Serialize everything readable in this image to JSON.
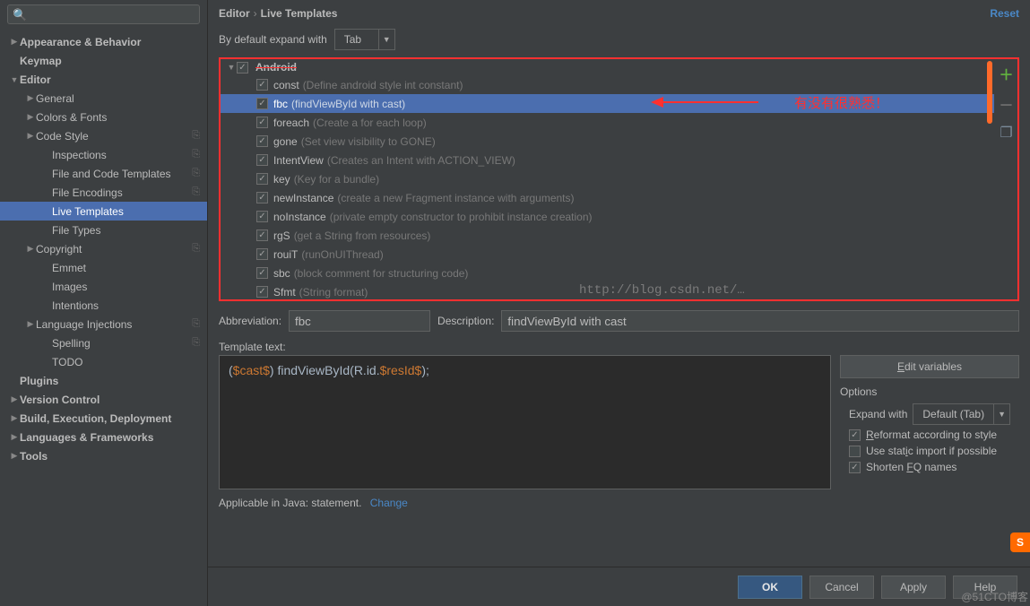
{
  "breadcrumb": {
    "root": "Editor",
    "leaf": "Live Templates"
  },
  "reset_label": "Reset",
  "expand_row": {
    "label": "By default expand with",
    "value": "Tab"
  },
  "sidebar": {
    "search_placeholder": "",
    "items": [
      {
        "label": "Appearance & Behavior",
        "bold": true,
        "indent": 0,
        "arrow": "closed"
      },
      {
        "label": "Keymap",
        "bold": true,
        "indent": 0
      },
      {
        "label": "Editor",
        "bold": true,
        "indent": 0,
        "arrow": "open"
      },
      {
        "label": "General",
        "indent": 1,
        "arrow": "closed"
      },
      {
        "label": "Colors & Fonts",
        "indent": 1,
        "arrow": "closed"
      },
      {
        "label": "Code Style",
        "indent": 1,
        "arrow": "closed",
        "copy": true
      },
      {
        "label": "Inspections",
        "indent": 2,
        "copy": true
      },
      {
        "label": "File and Code Templates",
        "indent": 2,
        "copy": true
      },
      {
        "label": "File Encodings",
        "indent": 2,
        "copy": true
      },
      {
        "label": "Live Templates",
        "indent": 2,
        "selected": true
      },
      {
        "label": "File Types",
        "indent": 2
      },
      {
        "label": "Copyright",
        "indent": 1,
        "arrow": "closed",
        "copy": true
      },
      {
        "label": "Emmet",
        "indent": 2
      },
      {
        "label": "Images",
        "indent": 2
      },
      {
        "label": "Intentions",
        "indent": 2
      },
      {
        "label": "Language Injections",
        "indent": 1,
        "arrow": "closed",
        "copy": true
      },
      {
        "label": "Spelling",
        "indent": 2,
        "copy": true
      },
      {
        "label": "TODO",
        "indent": 2
      },
      {
        "label": "Plugins",
        "bold": true,
        "indent": 0
      },
      {
        "label": "Version Control",
        "bold": true,
        "indent": 0,
        "arrow": "closed"
      },
      {
        "label": "Build, Execution, Deployment",
        "bold": true,
        "indent": 0,
        "arrow": "closed"
      },
      {
        "label": "Languages & Frameworks",
        "bold": true,
        "indent": 0,
        "arrow": "closed"
      },
      {
        "label": "Tools",
        "bold": true,
        "indent": 0,
        "arrow": "closed"
      }
    ]
  },
  "template_group": "Android",
  "templates": [
    {
      "abbr": "const",
      "desc": "(Define android style int constant)"
    },
    {
      "abbr": "fbc",
      "desc": "(findViewById with cast)",
      "selected": true
    },
    {
      "abbr": "foreach",
      "desc": "(Create a for each loop)"
    },
    {
      "abbr": "gone",
      "desc": "(Set view visibility to GONE)"
    },
    {
      "abbr": "IntentView",
      "desc": "(Creates an Intent with ACTION_VIEW)"
    },
    {
      "abbr": "key",
      "desc": "(Key for a bundle)"
    },
    {
      "abbr": "newInstance",
      "desc": "(create a new Fragment instance with arguments)"
    },
    {
      "abbr": "noInstance",
      "desc": "(private empty constructor to prohibit instance creation)"
    },
    {
      "abbr": "rgS",
      "desc": "(get a String from resources)"
    },
    {
      "abbr": "rouiT",
      "desc": "(runOnUIThread)"
    },
    {
      "abbr": "sbc",
      "desc": "(block comment for structuring code)"
    },
    {
      "abbr": "Sfmt",
      "desc": "(String format)"
    }
  ],
  "annotations": {
    "red_text": "有没有很熟悉！",
    "watermark": "http://blog.csdn.net/…"
  },
  "fields": {
    "abbrev_label": "Abbreviation:",
    "abbrev_value": "fbc",
    "desc_label": "Description:",
    "desc_value": "findViewById with cast",
    "template_text_label": "Template text:",
    "template_text_parts": {
      "p1": "(",
      "v1": "$cast$",
      "p2": ") findViewById(R.id.",
      "v2": "$resId$",
      "p3": ");"
    }
  },
  "right": {
    "edit_vars": "Edit variables",
    "options_title": "Options",
    "expand_with_label": "Expand with",
    "expand_with_value": "Default (Tab)",
    "reformat": "Reformat according to style",
    "static_import": "Use static import if possible",
    "shorten_fq": "Shorten FQ names"
  },
  "applicable": {
    "prefix": "Applicable in Java: statement.",
    "change": "Change"
  },
  "footer": {
    "ok": "OK",
    "cancel": "Cancel",
    "apply": "Apply",
    "help": "Help"
  },
  "corner_badge": "@51CTO博客"
}
